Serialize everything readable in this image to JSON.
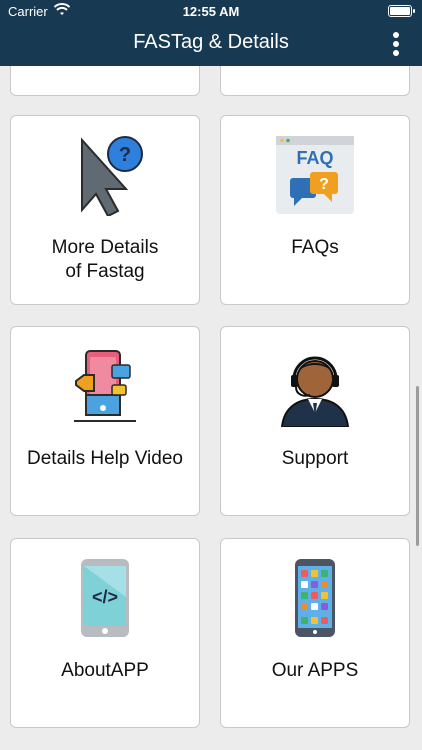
{
  "status": {
    "carrier": "Carrier",
    "time": "12:55 AM"
  },
  "header": {
    "title": "FASTag & Details"
  },
  "cards": [
    {
      "label": "More Details\nof Fastag",
      "icon": "cursor-question-icon"
    },
    {
      "label": "FAQs",
      "icon": "faq-icon"
    },
    {
      "label": "Details Help Video",
      "icon": "help-video-icon"
    },
    {
      "label": "Support",
      "icon": "support-agent-icon"
    },
    {
      "label": "AboutAPP",
      "icon": "code-phone-icon"
    },
    {
      "label": "Our APPS",
      "icon": "apps-phone-icon"
    }
  ]
}
